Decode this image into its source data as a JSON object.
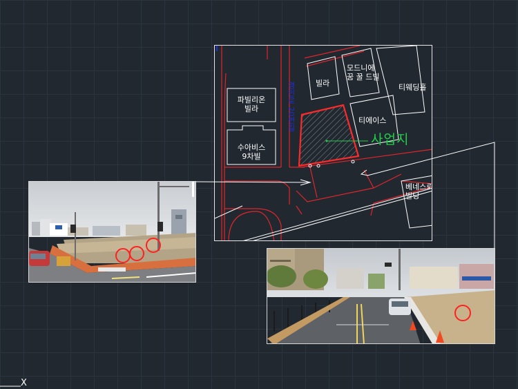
{
  "map": {
    "buildings": {
      "pavilion_villa": "파빌리온\n빌라",
      "suavis": "수아비스\n9차빌",
      "villa": "빌라",
      "modnie": "모드니에\n꿈 꿀 드빌",
      "tiwedding": "티웨딩홀",
      "tiace": "티에이스",
      "benes": "베네스뢰\n빌딩"
    },
    "road_name": "경인로 20번길",
    "site_label": "사업지"
  },
  "ucs_marker": "X",
  "colors": {
    "background": "#212830",
    "road_lines": "#e0262b",
    "site_outline": "#ff2a2a",
    "site_label": "#21d04a",
    "road_name": "#1f2fd0",
    "building_outline": "#ffffff"
  }
}
